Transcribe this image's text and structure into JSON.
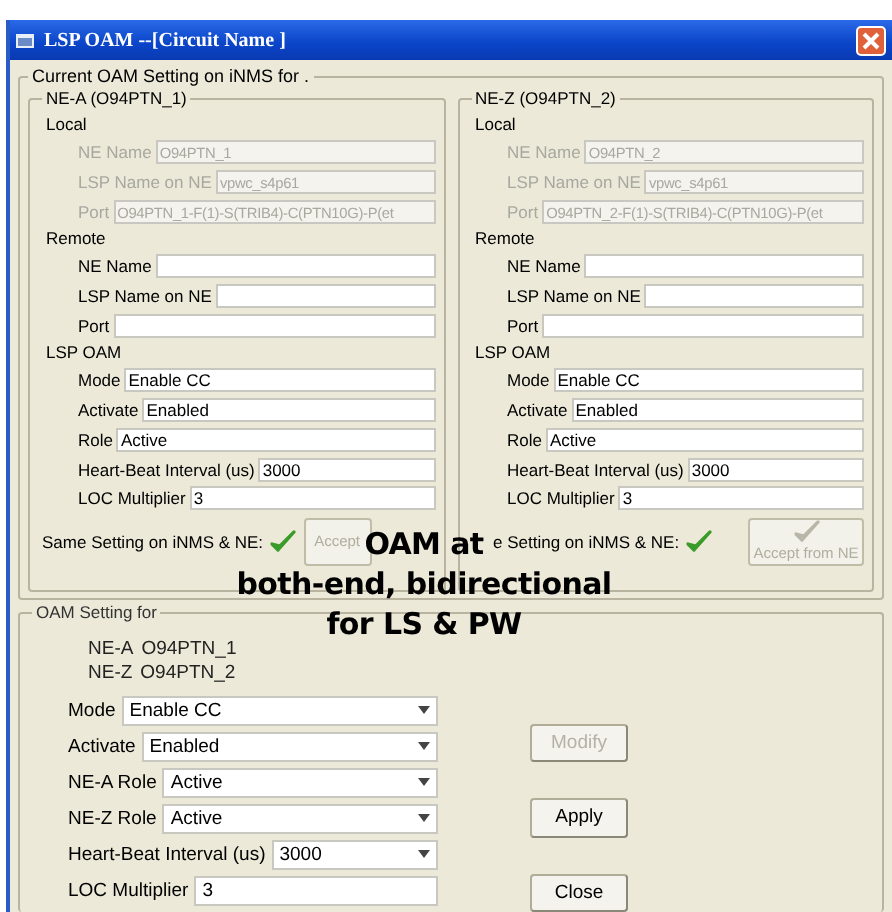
{
  "window": {
    "title": "LSP OAM --[Circuit Name ]"
  },
  "current": {
    "legend": "Current OAM Setting on iNMS for .",
    "panels": [
      {
        "legend": "NE-A (O94PTN_1)",
        "sections": [
          {
            "title": "Local",
            "fields": [
              {
                "label": "NE Name",
                "value": "O94PTN_1",
                "disabled": true
              },
              {
                "label": "LSP Name on NE",
                "value": "vpwc_s4p61",
                "disabled": true
              },
              {
                "label": "Port",
                "value": "O94PTN_1-F(1)-S(TRIB4)-C(PTN10G)-P(et",
                "disabled": true
              }
            ]
          },
          {
            "title": "Remote",
            "fields": [
              {
                "label": "NE Name",
                "disabled": false
              },
              {
                "label": "LSP Name on NE",
                "disabled": false
              },
              {
                "label": "Port",
                "disabled": false
              }
            ]
          },
          {
            "title": "LSP OAM",
            "fields": [
              {
                "label": "Mode",
                "value": "Enable CC",
                "disabled": false
              },
              {
                "label": "Activate",
                "value": "Enabled",
                "disabled": false
              },
              {
                "label": "Role",
                "value": "Active",
                "disabled": false
              },
              {
                "label": "Heart-Beat Interval (us)",
                "value": "3000",
                "disabled": false
              },
              {
                "label": "LOC Multiplier",
                "value": "3",
                "disabled": false
              }
            ]
          }
        ],
        "same_setting": {
          "label": "Same Setting on iNMS & NE:",
          "match": true
        },
        "accept": {
          "label": "Accept",
          "disabled": true,
          "icon": false
        }
      },
      {
        "legend": "NE-Z (O94PTN_2)",
        "sections": [
          {
            "title": "Local",
            "fields": [
              {
                "label": "NE Name",
                "value": "O94PTN_2",
                "disabled": true
              },
              {
                "label": "LSP Name on NE",
                "value": "vpwc_s4p61",
                "disabled": true
              },
              {
                "label": "Port",
                "value": "O94PTN_2-F(1)-S(TRIB4)-C(PTN10G)-P(et",
                "disabled": true
              }
            ]
          },
          {
            "title": "Remote",
            "fields": [
              {
                "label": "NE Name",
                "disabled": false
              },
              {
                "label": "LSP Name on NE",
                "disabled": false
              },
              {
                "label": "Port",
                "disabled": false
              }
            ]
          },
          {
            "title": "LSP OAM",
            "fields": [
              {
                "label": "Mode",
                "value": "Enable CC",
                "disabled": false
              },
              {
                "label": "Activate",
                "value": "Enabled",
                "disabled": false
              },
              {
                "label": "Role",
                "value": "Active",
                "disabled": false
              },
              {
                "label": "Heart-Beat Interval (us)",
                "value": "3000",
                "disabled": false
              },
              {
                "label": "LOC Multiplier",
                "value": "3",
                "disabled": false
              }
            ]
          }
        ],
        "same_setting": {
          "label": "e Setting on iNMS & NE:",
          "match": true
        },
        "accept": {
          "label": "Accept from NE",
          "disabled": true,
          "icon": true
        }
      }
    ]
  },
  "form": {
    "legend": "OAM Setting for",
    "endpoints": [
      {
        "label": "NE-A",
        "value": "O94PTN_1"
      },
      {
        "label": "NE-Z",
        "value": "O94PTN_2"
      }
    ],
    "fields": [
      {
        "label": "Mode",
        "value": "Enable CC",
        "kind": "dropdown"
      },
      {
        "label": "Activate",
        "value": "Enabled",
        "kind": "dropdown"
      },
      {
        "label": "NE-A Role",
        "value": "Active",
        "kind": "dropdown"
      },
      {
        "label": "NE-Z Role",
        "value": "Active",
        "kind": "dropdown"
      },
      {
        "label": "Heart-Beat Interval (us)",
        "value": "3000",
        "kind": "dropdown"
      },
      {
        "label": "LOC Multiplier",
        "value": "3",
        "kind": "text"
      }
    ],
    "buttons": [
      {
        "label": "Modify",
        "disabled": true
      },
      {
        "label": "Apply",
        "disabled": false
      },
      {
        "label": "Close",
        "disabled": false
      }
    ]
  },
  "annotation": {
    "lines": [
      "OAM at",
      "both-end, bidirectional",
      "for LS & PW"
    ]
  }
}
